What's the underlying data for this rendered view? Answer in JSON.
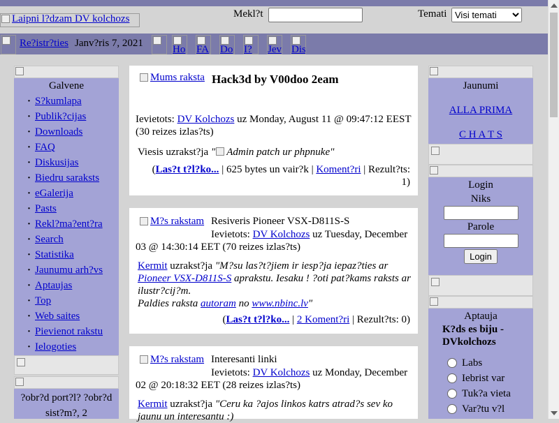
{
  "header": {
    "logo_alt": "Laipni l?dzam DV kolchozs",
    "search_label": "Mekl?t",
    "topics_label": "Temati",
    "topics_selected": "Visi temati"
  },
  "nav": {
    "register": "Re?istr?ties",
    "date": "Janv?ris 7, 2021",
    "icons": [
      "Ho",
      "FA",
      "Do",
      "I?",
      "Jev",
      "Dis"
    ]
  },
  "left_menu": {
    "title": "Galvene",
    "items": [
      "S?kumlapa",
      "Publik?cijas",
      "Downloads",
      "FAQ",
      "Diskusijas",
      "Biedru saraksts",
      "eGalerija",
      "Pasts",
      "Rekl?ma?ent?ra",
      "Search",
      "Statistika",
      "Jaunumu arh?vs",
      "Aptaujas",
      "Top",
      "Web saites",
      "Pievienot rakstu",
      "Ielogoties"
    ]
  },
  "left_block2": {
    "text": "?obr?d port?l? ?obr?d sist?m?, 2"
  },
  "posts": [
    {
      "image_alt": "Mums raksta",
      "title": "Hack3d by V00doo 2eam",
      "posted_label": "Ievietots:",
      "author": "DV Kolchozs",
      "date_text": "uz Monday, August 11 @ 09:47:12 EEST (30 reizes izlas?ts)",
      "writer_prefix": "Viesis uzrakst?ja",
      "quote": "Admin patch ur phpnuke",
      "read_more": "Las?t t?l?ko...",
      "bytes": "| 625 bytes un vair?k |",
      "comments": "Koment?ri",
      "rating": "| Rezult?ts: 1)"
    },
    {
      "image_alt": "M?s rakstam",
      "title": "Resiveris Pioneer VSX-D811S-S",
      "posted_label": "Ievietots:",
      "author": "DV Kolchozs",
      "date_text": "uz Tuesday, December 03 @ 14:30:14 EET (70 reizes izlas?ts)",
      "writer": "Kermit",
      "writer_verb": "uzrakst?ja",
      "quote_a": "M?su las?t?jiem ir iesp?ja iepaz?ties ar",
      "quote_link": "Pioneer VSX-D811S-S",
      "quote_b": "aprakstu. Iesaku ! ?oti pat?kams raksts ar ilustr?cij?m.",
      "quote_c": "Paldies raksta",
      "quote_link2": "autoram",
      "quote_d": "no",
      "quote_link3": "www.nbinc.lv",
      "read_more": "Las?t t?l?ko...",
      "comments": "2 Koment?ri",
      "rating": "| Rezult?ts: 0)"
    },
    {
      "image_alt": "M?s rakstam",
      "title": "Interesanti linki",
      "posted_label": "Ievietots:",
      "author": "DV Kolchozs",
      "date_text": "uz Monday, December 02 @ 20:18:32 EET (28 reizes izlas?ts)",
      "writer": "Kermit",
      "writer_verb": "uzrakst?ja",
      "quote": "Ceru ka ?ajos linkos katrs atrad?s sev ko jaunu un interesantu :)"
    }
  ],
  "right": {
    "news_title": "Jaunumi",
    "news_link1": "ALLA PRIMA",
    "news_link2": "C H A T S",
    "login_title": "Login",
    "login_name_label": "Niks",
    "login_pass_label": "Parole",
    "login_button": "Login",
    "poll_title": "Aptauja",
    "poll_question": "K?ds es biju - DVkolchozs",
    "poll_options": [
      "Labs",
      "Iebrist var",
      "Tuk?a vieta",
      "Var?tu v?l"
    ]
  }
}
